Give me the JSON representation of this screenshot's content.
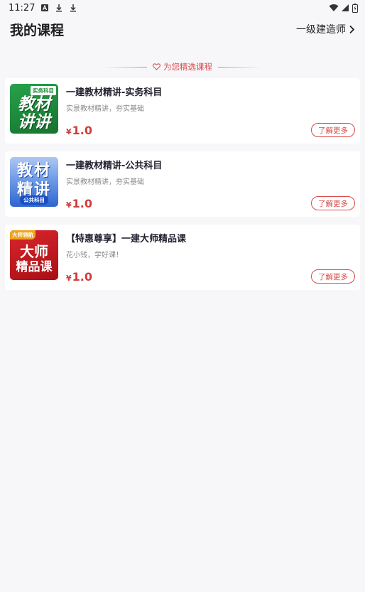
{
  "status_bar": {
    "time": "11:27"
  },
  "header": {
    "title": "我的课程",
    "level": "一级建造师"
  },
  "section": {
    "title": "为您精选课程"
  },
  "courses": [
    {
      "name": "一建教材精讲-实务科目",
      "desc": "实景教材精讲，夯实基础",
      "currency": "¥",
      "price": "1.0",
      "button": "了解更多",
      "thumb": {
        "line1": "教材",
        "line2": "讲讲",
        "tag": "实务科目",
        "bg": "#1f8a3a"
      }
    },
    {
      "name": "一建教材精讲-公共科目",
      "desc": "实景教材精讲，夯实基础",
      "currency": "¥",
      "price": "1.0",
      "button": "了解更多",
      "thumb": {
        "line1": "教材",
        "line2": "精讲",
        "tag": "公共科目",
        "bg": "#3b74d8"
      }
    },
    {
      "name": "【特惠尊享】一建大师精品课",
      "desc": "花小钱，学好课！",
      "currency": "¥",
      "price": "1.0",
      "button": "了解更多",
      "thumb": {
        "line1": "大师",
        "line2": "精品课",
        "tag": "大师领航",
        "bg": "#c4161c"
      }
    }
  ],
  "colors": {
    "accent": "#d94a4a",
    "background": "#f7f7f9"
  }
}
